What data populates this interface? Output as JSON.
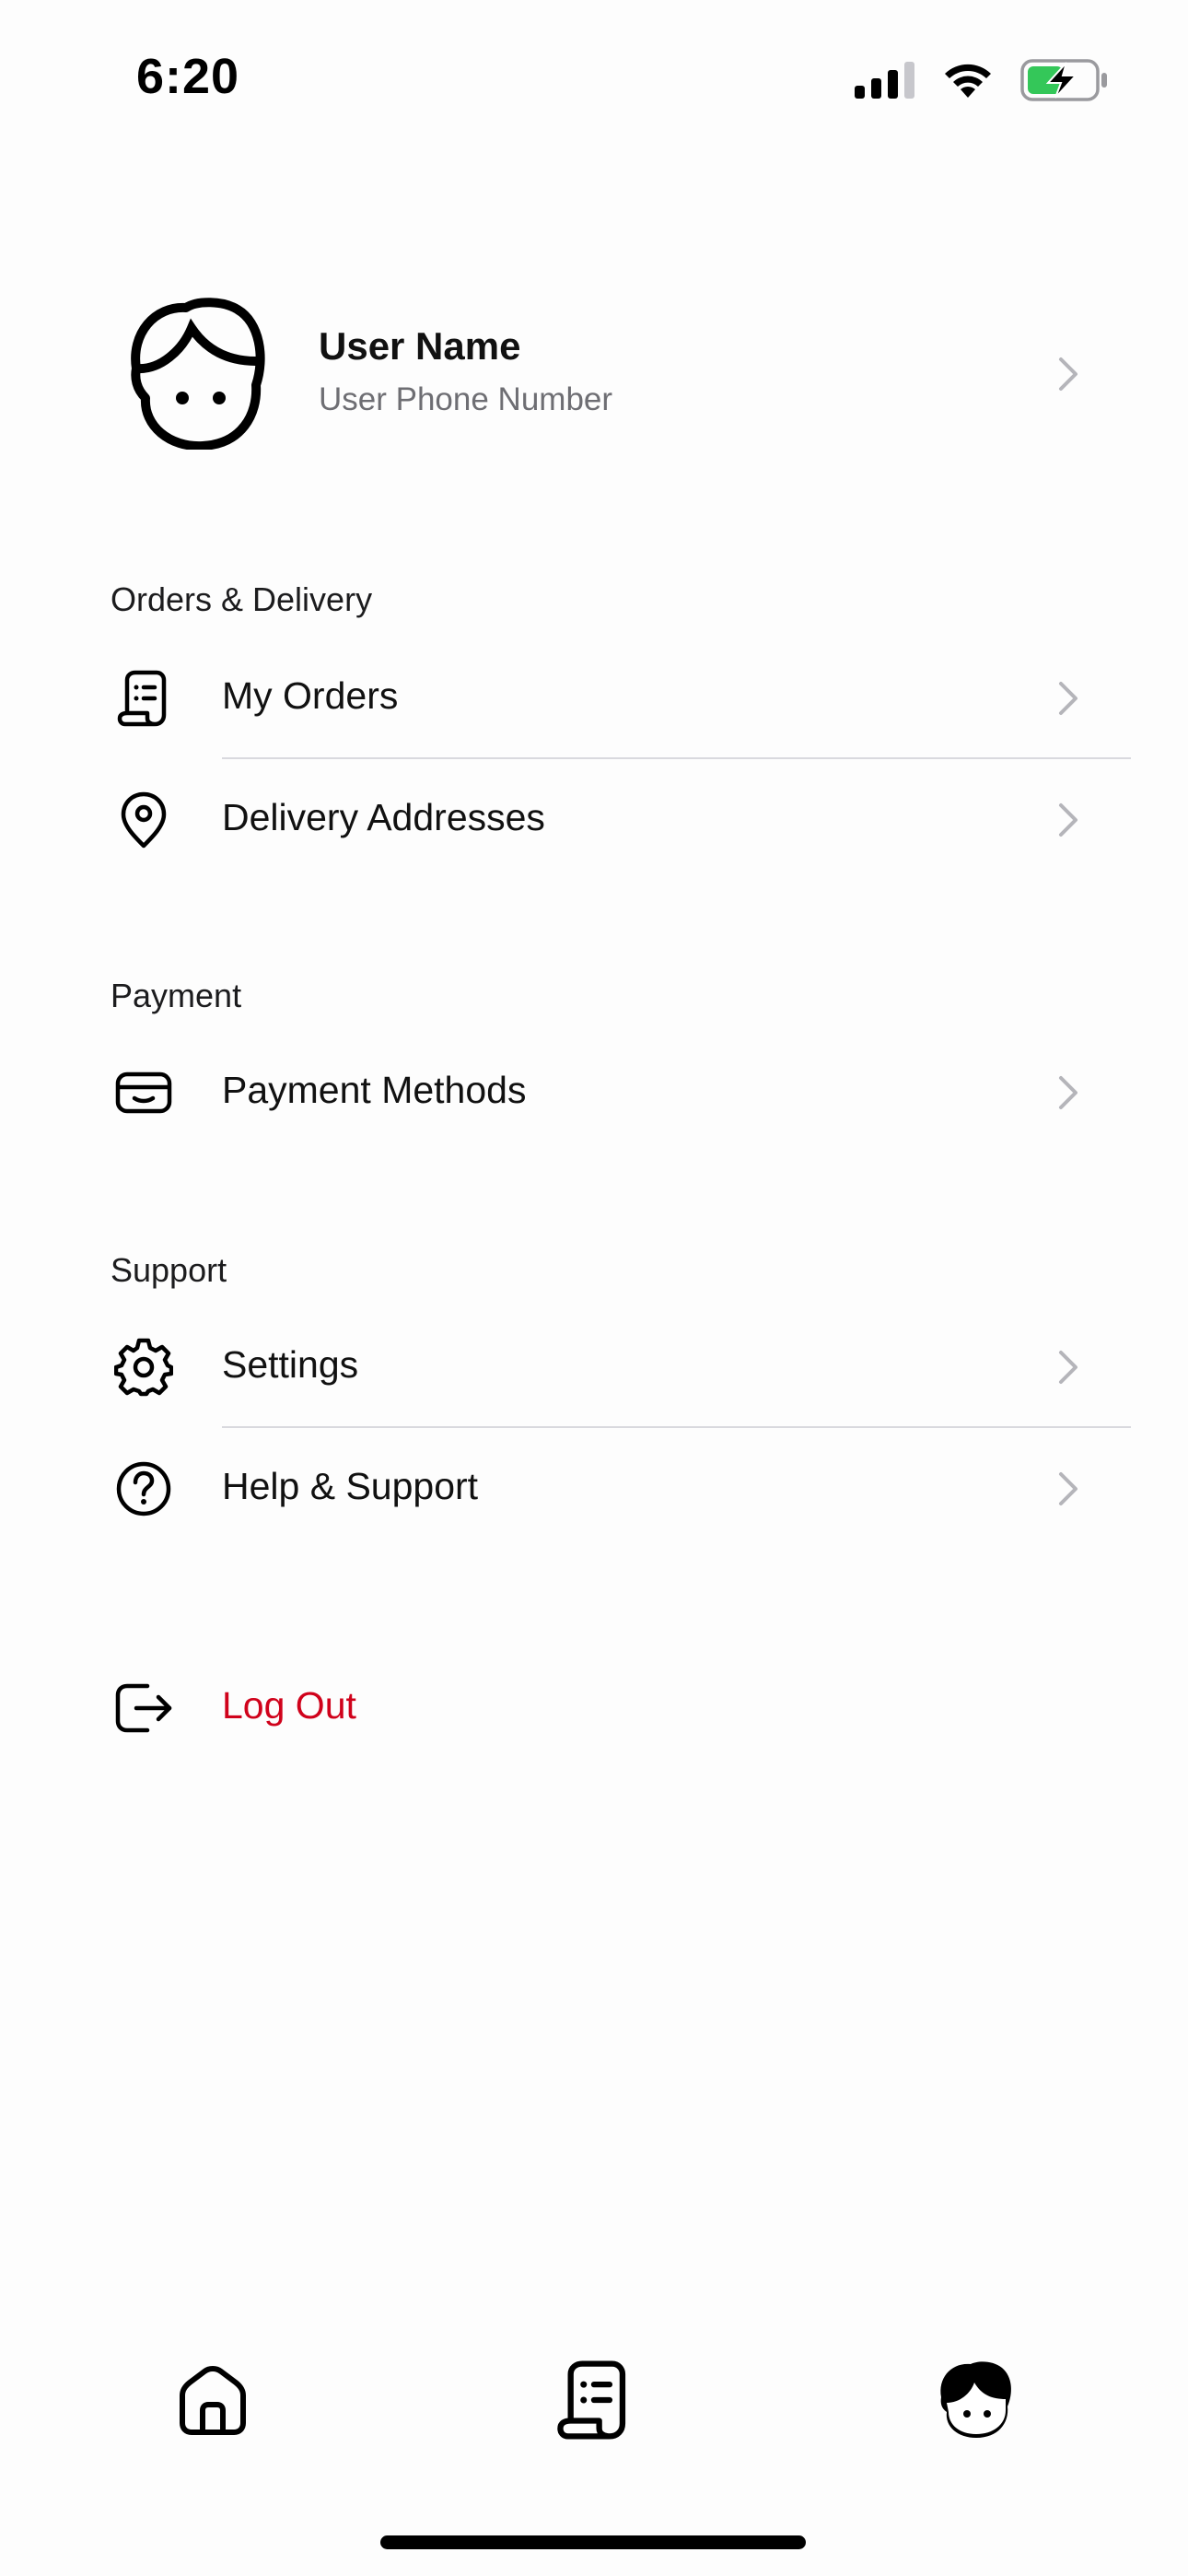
{
  "status_bar": {
    "time": "6:20",
    "icons": [
      "cellular-signal-icon",
      "wifi-icon",
      "battery-charging-icon"
    ],
    "battery_color": "#34c759"
  },
  "profile": {
    "name": "User Name",
    "phone": "User Phone Number",
    "avatar_icon": "user-avatar-icon"
  },
  "sections": [
    {
      "title": "Orders & Delivery",
      "items": [
        {
          "label": "My Orders",
          "icon": "receipt-icon"
        },
        {
          "label": "Delivery Addresses",
          "icon": "location-pin-icon"
        }
      ]
    },
    {
      "title": "Payment",
      "items": [
        {
          "label": "Payment Methods",
          "icon": "wallet-icon"
        }
      ]
    },
    {
      "title": "Support",
      "items": [
        {
          "label": "Settings",
          "icon": "gear-icon"
        },
        {
          "label": "Help & Support",
          "icon": "question-circle-icon"
        }
      ]
    }
  ],
  "logout": {
    "label": "Log Out",
    "icon": "logout-icon",
    "color": "#d0021b"
  },
  "tab_bar": {
    "tabs": [
      {
        "name": "home",
        "icon": "home-icon"
      },
      {
        "name": "orders",
        "icon": "receipt-icon"
      },
      {
        "name": "profile",
        "icon": "user-avatar-icon",
        "active": true
      }
    ]
  }
}
